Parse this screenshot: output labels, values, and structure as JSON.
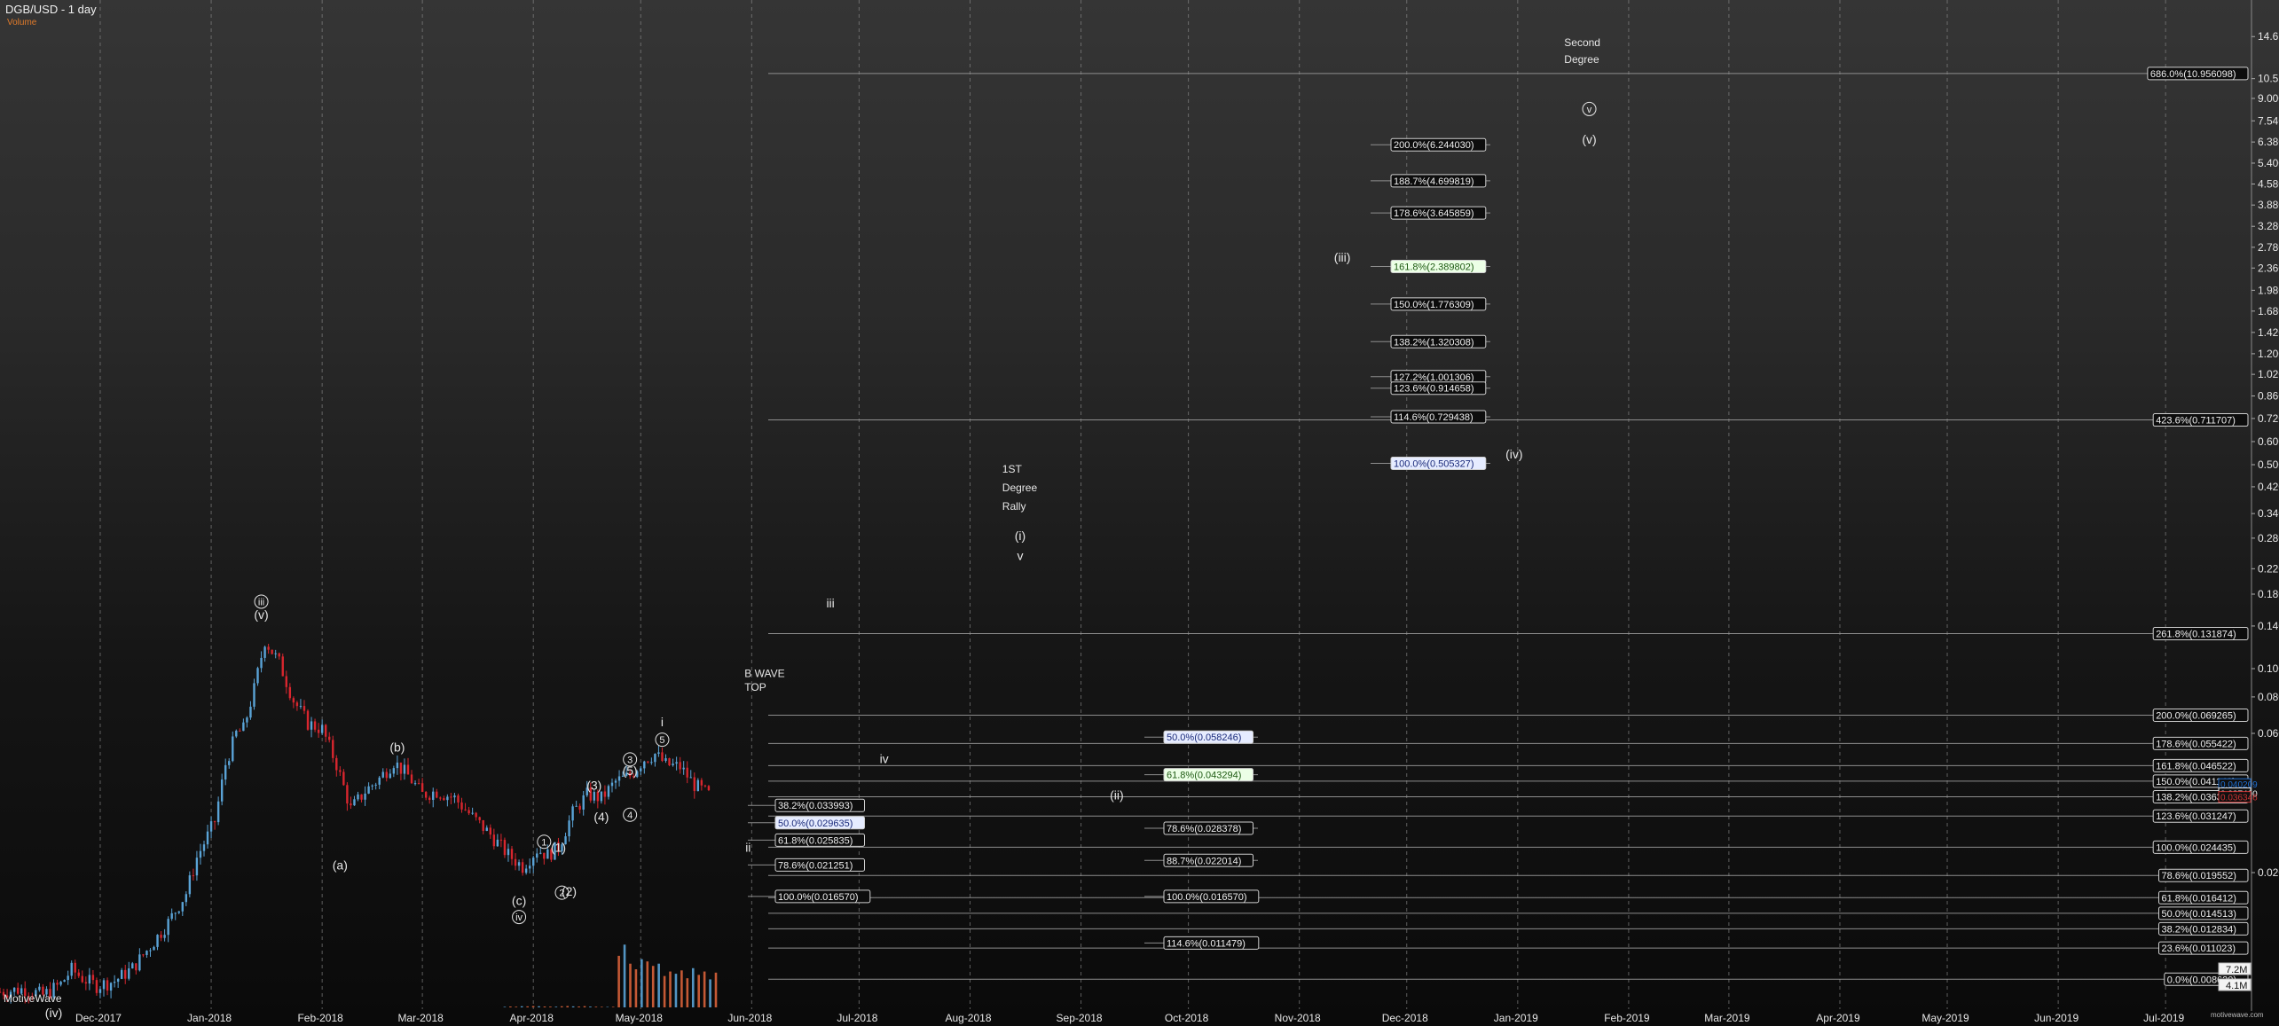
{
  "header": {
    "title": "DGB/USD - 1 day",
    "subtitle": "Volume"
  },
  "footer": {
    "brand": "MotiveWave",
    "credit": "motivewave.com"
  },
  "colors": {
    "up": "#5aa3d6",
    "down": "#d8262e",
    "grid": "#8a8a8a",
    "text": "#e6e6e6",
    "fib_line": "#9a9a9a",
    "volume": "#d8623a"
  },
  "chart_data": {
    "type": "candlestick",
    "x_axis": {
      "type": "date",
      "tick_labels": [
        {
          "label": "Dec-2017",
          "date": "2017-12-01"
        },
        {
          "label": "Jan-2018",
          "date": "2018-01-01"
        },
        {
          "label": "Feb-2018",
          "date": "2018-02-01"
        },
        {
          "label": "Mar-2018",
          "date": "2018-03-01"
        },
        {
          "label": "Apr-2018",
          "date": "2018-04-01"
        },
        {
          "label": "May-2018",
          "date": "2018-05-01"
        },
        {
          "label": "Jun-2018",
          "date": "2018-06-01"
        },
        {
          "label": "Jul-2018",
          "date": "2018-07-01"
        },
        {
          "label": "Aug-2018",
          "date": "2018-08-01"
        },
        {
          "label": "Sep-2018",
          "date": "2018-09-01"
        },
        {
          "label": "Oct-2018",
          "date": "2018-10-01"
        },
        {
          "label": "Nov-2018",
          "date": "2018-11-01"
        },
        {
          "label": "Dec-2018",
          "date": "2018-12-01"
        },
        {
          "label": "Jan-2019",
          "date": "2019-01-01"
        },
        {
          "label": "Feb-2019",
          "date": "2019-02-01"
        },
        {
          "label": "Mar-2019",
          "date": "2019-03-01"
        },
        {
          "label": "Apr-2019",
          "date": "2019-04-01"
        },
        {
          "label": "May-2019",
          "date": "2019-05-01"
        },
        {
          "label": "Jun-2019",
          "date": "2019-06-01"
        },
        {
          "label": "Jul-2019",
          "date": "2019-07-01"
        }
      ],
      "range": [
        "2017-11-03",
        "2019-07-25"
      ]
    },
    "y_axis": {
      "scale": "log",
      "range": [
        0.0072,
        18.5
      ],
      "tick_labels": [
        "14.660000",
        "10.520000",
        "9.000000",
        "7.540000",
        "6.380000",
        "5.400000",
        "4.580000",
        "3.880000",
        "3.280000",
        "2.780000",
        "2.360000",
        "1.980000",
        "1.680000",
        "1.420000",
        "1.200000",
        "1.020000",
        "0.860000",
        "0.720000",
        "0.600000",
        "0.500000",
        "0.420000",
        "0.340000",
        "0.280000",
        "0.220000",
        "0.180000",
        "0.140000",
        "0.100000",
        "0.080000",
        "0.060000",
        "0.020000"
      ]
    },
    "grid": true,
    "price_series": [
      [
        "2017-11-03",
        0.0078
      ],
      [
        "2017-11-10",
        0.008
      ],
      [
        "2017-11-15",
        0.0076
      ],
      [
        "2017-11-20",
        0.0083
      ],
      [
        "2017-11-23",
        0.0093
      ],
      [
        "2017-11-26",
        0.0087
      ],
      [
        "2017-11-30",
        0.0082
      ],
      [
        "2017-12-05",
        0.0085
      ],
      [
        "2017-12-10",
        0.0094
      ],
      [
        "2017-12-15",
        0.0112
      ],
      [
        "2017-12-20",
        0.0135
      ],
      [
        "2017-12-25",
        0.017
      ],
      [
        "2017-12-28",
        0.0225
      ],
      [
        "2018-01-02",
        0.03
      ],
      [
        "2018-01-05",
        0.047
      ],
      [
        "2018-01-08",
        0.06
      ],
      [
        "2018-01-10",
        0.062
      ],
      [
        "2018-01-13",
        0.085
      ],
      [
        "2018-01-16",
        0.125
      ],
      [
        "2018-01-20",
        0.105
      ],
      [
        "2018-01-24",
        0.078
      ],
      [
        "2018-01-28",
        0.065
      ],
      [
        "2018-02-01",
        0.062
      ],
      [
        "2018-02-05",
        0.047
      ],
      [
        "2018-02-09",
        0.033
      ],
      [
        "2018-02-13",
        0.038
      ],
      [
        "2018-02-17",
        0.042
      ],
      [
        "2018-02-21",
        0.048
      ],
      [
        "2018-02-25",
        0.043
      ],
      [
        "2018-03-01",
        0.037
      ],
      [
        "2018-03-05",
        0.038
      ],
      [
        "2018-03-10",
        0.036
      ],
      [
        "2018-03-15",
        0.031
      ],
      [
        "2018-03-20",
        0.027
      ],
      [
        "2018-03-25",
        0.023
      ],
      [
        "2018-03-29",
        0.021
      ],
      [
        "2018-04-02",
        0.024
      ],
      [
        "2018-04-05",
        0.023
      ],
      [
        "2018-04-08",
        0.0245
      ],
      [
        "2018-04-12",
        0.032
      ],
      [
        "2018-04-16",
        0.037
      ],
      [
        "2018-04-20",
        0.036
      ],
      [
        "2018-04-24",
        0.041
      ],
      [
        "2018-04-28",
        0.043
      ],
      [
        "2018-05-02",
        0.049
      ],
      [
        "2018-05-05",
        0.051
      ],
      [
        "2018-05-08",
        0.047
      ],
      [
        "2018-05-12",
        0.046
      ],
      [
        "2018-05-16",
        0.04
      ],
      [
        "2018-05-20",
        0.037
      ]
    ],
    "volume": {
      "values_in_millions": [
        0.05,
        0.08,
        0.06,
        0.1,
        0.09,
        0.12,
        0.1,
        0.08,
        0.07,
        0.06,
        0.1,
        0.12,
        0.09,
        0.08,
        0.11,
        0.07,
        0.06,
        0.05,
        0.04,
        0.05,
        4.6,
        5.6,
        3.9,
        3.4,
        4.3,
        4.1,
        3.7,
        3.9,
        2.8,
        3.2,
        3.0,
        3.3,
        2.6,
        3.5,
        2.9,
        3.2,
        2.5,
        3.1
      ],
      "start": "2018-03-24",
      "end": "2018-05-22",
      "axis_labels": [
        "7.2M",
        "4.1M"
      ]
    },
    "fib_levels": [
      {
        "label": "686.0%(10.956098)",
        "value": 10.956098,
        "side": "right"
      },
      {
        "label": "423.6%(0.711707)",
        "value": 0.711707,
        "side": "right"
      },
      {
        "label": "261.8%(0.131874)",
        "value": 0.131874,
        "side": "right"
      },
      {
        "label": "200.0%(0.069265)",
        "value": 0.069265,
        "side": "right"
      },
      {
        "label": "178.6%(0.055422)",
        "value": 0.055422,
        "side": "right"
      },
      {
        "label": "161.8%(0.046522)",
        "value": 0.046522,
        "side": "right"
      },
      {
        "label": "150.0%(0.041140)",
        "value": 0.04114,
        "side": "right"
      },
      {
        "label": "138.2%(0.036381)",
        "value": 0.036381,
        "side": "right"
      },
      {
        "label": "123.6%(0.031247)",
        "value": 0.031247,
        "side": "right"
      },
      {
        "label": "100.0%(0.024435)",
        "value": 0.024435,
        "side": "right"
      },
      {
        "label": "78.6%(0.019552)",
        "value": 0.019552,
        "side": "right"
      },
      {
        "label": "61.8%(0.016412)",
        "value": 0.016412,
        "side": "right"
      },
      {
        "label": "50.0%(0.014513)",
        "value": 0.014513,
        "side": "right"
      },
      {
        "label": "38.2%(0.012834)",
        "value": 0.012834,
        "side": "right"
      },
      {
        "label": "23.6%(0.011023)",
        "value": 0.011023,
        "side": "right"
      },
      {
        "label": "0.0%(0.008620)",
        "value": 0.00862,
        "side": "right"
      },
      {
        "label": "38.2%(0.033993)",
        "value": 0.033993,
        "side": "leftA"
      },
      {
        "label": "50.0%(0.029635)",
        "value": 0.029635,
        "side": "leftA",
        "highlight": "blue"
      },
      {
        "label": "61.8%(0.025835)",
        "value": 0.025835,
        "side": "leftA"
      },
      {
        "label": "78.6%(0.021251)",
        "value": 0.021251,
        "side": "leftA"
      },
      {
        "label": "100.0%(0.016570)",
        "value": 0.01657,
        "side": "leftA"
      },
      {
        "label": "50.0%(0.058246)",
        "value": 0.058246,
        "side": "leftB",
        "highlight": "blue"
      },
      {
        "label": "61.8%(0.043294)",
        "value": 0.043294,
        "side": "leftB",
        "highlight": "green"
      },
      {
        "label": "78.6%(0.028378)",
        "value": 0.028378,
        "side": "leftB"
      },
      {
        "label": "88.7%(0.022014)",
        "value": 0.022014,
        "side": "leftB"
      },
      {
        "label": "100.0%(0.016570)",
        "value": 0.01657,
        "side": "leftB"
      },
      {
        "label": "114.6%(0.011479)",
        "value": 0.011479,
        "side": "leftB"
      },
      {
        "label": "200.0%(6.244030)",
        "value": 6.24403,
        "side": "leftC"
      },
      {
        "label": "188.7%(4.699819)",
        "value": 4.699819,
        "side": "leftC"
      },
      {
        "label": "178.6%(3.645859)",
        "value": 3.645859,
        "side": "leftC"
      },
      {
        "label": "161.8%(2.389802)",
        "value": 2.389802,
        "side": "leftC",
        "highlight": "green"
      },
      {
        "label": "150.0%(1.776309)",
        "value": 1.776309,
        "side": "leftC"
      },
      {
        "label": "138.2%(1.320308)",
        "value": 1.320308,
        "side": "leftC"
      },
      {
        "label": "127.2%(1.001306)",
        "value": 1.001306,
        "side": "leftC"
      },
      {
        "label": "123.6%(0.914658)",
        "value": 0.914658,
        "side": "leftC"
      },
      {
        "label": "114.6%(0.729438)",
        "value": 0.729438,
        "side": "leftC"
      },
      {
        "label": "100.0%(0.505327)",
        "value": 0.505327,
        "side": "leftC",
        "highlight": "blue"
      }
    ],
    "price_markers": [
      {
        "label": "0.040209",
        "value": 0.040209,
        "color": "#1f6fd1"
      },
      {
        "label": "0.037400",
        "value": 0.0374,
        "color": "#f0f0f0"
      },
      {
        "label": "0.036346",
        "value": 0.036346,
        "color": "#c33"
      }
    ],
    "wave_labels": [
      {
        "text": "(iv)",
        "date": "2017-11-18",
        "value": 0.0064
      },
      {
        "text": "iii",
        "date": "2018-01-15",
        "value": 0.165,
        "circled": true
      },
      {
        "text": "(v)",
        "date": "2018-01-15",
        "value": 0.148
      },
      {
        "text": "(b)",
        "date": "2018-02-22",
        "value": 0.052
      },
      {
        "text": "(a)",
        "date": "2018-02-06",
        "value": 0.0205
      },
      {
        "text": "(c)",
        "date": "2018-03-28",
        "value": 0.0155
      },
      {
        "text": "iv",
        "date": "2018-03-28",
        "value": 0.0137,
        "circled": true
      },
      {
        "text": "1",
        "date": "2018-04-04",
        "value": 0.0248,
        "circled": true
      },
      {
        "text": "(1)",
        "date": "2018-04-08",
        "value": 0.0236
      },
      {
        "text": "2",
        "date": "2018-04-09",
        "value": 0.0166,
        "circled": true
      },
      {
        "text": "(2)",
        "date": "2018-04-11",
        "value": 0.0167
      },
      {
        "text": "(3)",
        "date": "2018-04-18",
        "value": 0.0385
      },
      {
        "text": "(4)",
        "date": "2018-04-20",
        "value": 0.03
      },
      {
        "text": "3",
        "date": "2018-04-28",
        "value": 0.0475,
        "circled": true
      },
      {
        "text": "(5)",
        "date": "2018-04-28",
        "value": 0.0432
      },
      {
        "text": "4",
        "date": "2018-04-28",
        "value": 0.0307,
        "circled": true
      },
      {
        "text": "5",
        "date": "2018-05-07",
        "value": 0.0555,
        "circled": true
      },
      {
        "text": "i",
        "date": "2018-05-07",
        "value": 0.0635
      },
      {
        "text": "ii",
        "date": "2018-05-31",
        "value": 0.0236
      },
      {
        "text": "iii",
        "date": "2018-06-23",
        "value": 0.162
      },
      {
        "text": "iv",
        "date": "2018-07-08",
        "value": 0.0475
      },
      {
        "text": "(ii)",
        "date": "2018-09-11",
        "value": 0.0356
      },
      {
        "text": "(i)",
        "date": "2018-08-15",
        "value": 0.276
      },
      {
        "text": "v",
        "date": "2018-08-15",
        "value": 0.236
      },
      {
        "text": "(iii)",
        "date": "2018-11-13",
        "value": 2.48
      },
      {
        "text": "(iv)",
        "date": "2018-12-31",
        "value": 0.525
      },
      {
        "text": "v",
        "date": "2019-01-21",
        "value": 8.05,
        "circled": true
      },
      {
        "text": "(v)",
        "date": "2019-01-21",
        "value": 6.3
      }
    ],
    "annotations": [
      {
        "text": "B WAVE",
        "date": "2018-05-30",
        "value": 0.0935
      },
      {
        "text": "TOP",
        "date": "2018-05-30",
        "value": 0.084
      },
      {
        "text": "1ST",
        "date": "2018-08-10",
        "value": 0.47
      },
      {
        "text": "Degree",
        "date": "2018-08-10",
        "value": 0.405
      },
      {
        "text": "Rally",
        "date": "2018-08-10",
        "value": 0.35
      },
      {
        "text": "Second",
        "date": "2019-01-14",
        "value": 13.6
      },
      {
        "text": "Degree",
        "date": "2019-01-14",
        "value": 11.9
      }
    ]
  }
}
